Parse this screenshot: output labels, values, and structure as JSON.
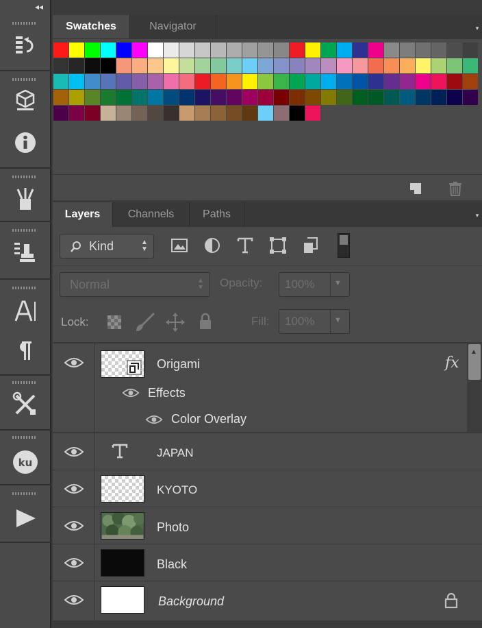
{
  "swatches_panel": {
    "tabs": [
      {
        "label": "Swatches",
        "active": true
      },
      {
        "label": "Navigator",
        "active": false
      }
    ],
    "colors": [
      "#ff1a1a",
      "#ffff00",
      "#00ff00",
      "#00ffff",
      "#0000ff",
      "#ff00ff",
      "#ffffff",
      "#ebebeb",
      "#d6d6d6",
      "#c7c7c7",
      "#b8b8b8",
      "#adadad",
      "#a0a0a0",
      "#959595",
      "#888888",
      "#ee1c24",
      "#fff200",
      "#00a651",
      "#00aeef",
      "#2e3192",
      "#ec008c",
      "#8a8a8a",
      "#7d7d7d",
      "#707070",
      "#646464",
      "#4d4d4d",
      "#404040",
      "#333333",
      "#262626",
      "#0d0d0d",
      "#000000",
      "#f7977a",
      "#f9ad81",
      "#fdc68a",
      "#fff79a",
      "#c4df9b",
      "#a2d39c",
      "#82ca9d",
      "#7bcdc8",
      "#6ecff6",
      "#7ea7d8",
      "#8493ca",
      "#8882be",
      "#a187be",
      "#bc8dbf",
      "#f49ac2",
      "#f6989d",
      "#f26c4f",
      "#f68e55",
      "#fbaf5c",
      "#fff467",
      "#acd372",
      "#7cc576",
      "#3bb878",
      "#1abbb4",
      "#00bff3",
      "#438ccb",
      "#5574b9",
      "#605ca8",
      "#855fa8",
      "#a763a8",
      "#f06ea9",
      "#f26d7d",
      "#ed1c24",
      "#f26522",
      "#f7941d",
      "#fff200",
      "#8dc63f",
      "#39b54a",
      "#00a651",
      "#00a99d",
      "#00aeef",
      "#0072bc",
      "#0054a6",
      "#2e3192",
      "#662d91",
      "#92278f",
      "#ec008c",
      "#ed145b",
      "#9e0b0f",
      "#a0410d",
      "#a36209",
      "#aba000",
      "#598527",
      "#1a7b30",
      "#007236",
      "#00746b",
      "#0076a3",
      "#004b80",
      "#003471",
      "#1b1464",
      "#440e62",
      "#630460",
      "#9e005d",
      "#9e0039",
      "#790000",
      "#7b2e00",
      "#7d4900",
      "#827b00",
      "#406618",
      "#005e20",
      "#005826",
      "#005952",
      "#005b7f",
      "#003663",
      "#002157",
      "#0d004c",
      "#32004b",
      "#4b0049",
      "#7b0046",
      "#7a0026",
      "#c7b299",
      "#998675",
      "#736357",
      "#534741",
      "#37302d",
      "#c69c6d",
      "#a67c52",
      "#8c6239",
      "#754c24",
      "#603913",
      "#6dcff6",
      "#8c6d74",
      "#000000",
      "#ed145b"
    ]
  },
  "layers_panel": {
    "tabs": [
      {
        "label": "Layers",
        "active": true
      },
      {
        "label": "Channels",
        "active": false
      },
      {
        "label": "Paths",
        "active": false
      }
    ],
    "filter": {
      "label": "Kind"
    },
    "blend_mode": "Normal",
    "opacity_label": "Opacity:",
    "opacity_value": "100%",
    "lock_label": "Lock:",
    "fill_label": "Fill:",
    "fill_value": "100%",
    "layers": [
      {
        "name": "Origami",
        "fx_label": "fx",
        "effects_label": "Effects",
        "effect_name": "Color Overlay"
      },
      {
        "name": "JAPAN"
      },
      {
        "name": "KYOTO"
      },
      {
        "name": "Photo"
      },
      {
        "name": "Black"
      },
      {
        "name": "Background"
      }
    ]
  }
}
